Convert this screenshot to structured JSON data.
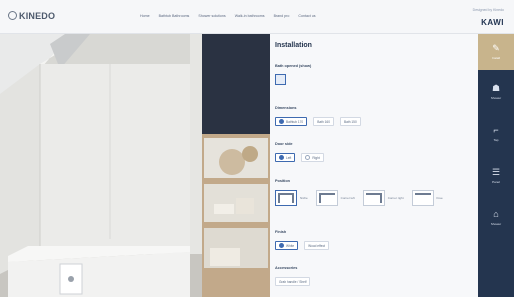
{
  "app": {
    "logo_text": "KINEDO"
  },
  "nav": {
    "items": [
      "Home",
      "Bathtub Bathrooms",
      "Shower solutions",
      "Walk-in bathrooms",
      "Brand pro",
      "Contact us"
    ]
  },
  "brand": {
    "small_text": "Designed by Kinedo",
    "name": "KAWI"
  },
  "panel": {
    "title": "Installation",
    "sections": {
      "bath": {
        "label": "Bath opened (show)"
      },
      "dimension": {
        "label": "Dimensions",
        "options": [
          "Bathtub 170",
          "Bath 160",
          "Bath 150"
        ],
        "selected": 0
      },
      "opening": {
        "label": "Door side",
        "options": [
          "Left",
          "Right"
        ],
        "selected": 0
      },
      "position": {
        "label": "Position",
        "options": [
          "Niche",
          "Corner left",
          "Corner right",
          "Free"
        ],
        "selected": 0
      },
      "finish": {
        "label": "Finish",
        "options": [
          "White",
          "Wood effect"
        ],
        "selected": 0
      },
      "accessories": {
        "label": "Accessories",
        "options": [
          "Grab handle / Shelf"
        ]
      }
    }
  },
  "sidebar": {
    "items": [
      {
        "label": "Install",
        "icon": "pencil-icon"
      },
      {
        "label": "Shower",
        "icon": "shower-icon"
      },
      {
        "label": "Tap",
        "icon": "tap-icon"
      },
      {
        "label": "Panel",
        "icon": "panel-icon"
      },
      {
        "label": "Shower",
        "icon": "head-icon"
      }
    ],
    "active": 0
  },
  "colors": {
    "accent": "#3e6ab0",
    "sidebar": "#24354f",
    "active": "#c8b48c"
  }
}
